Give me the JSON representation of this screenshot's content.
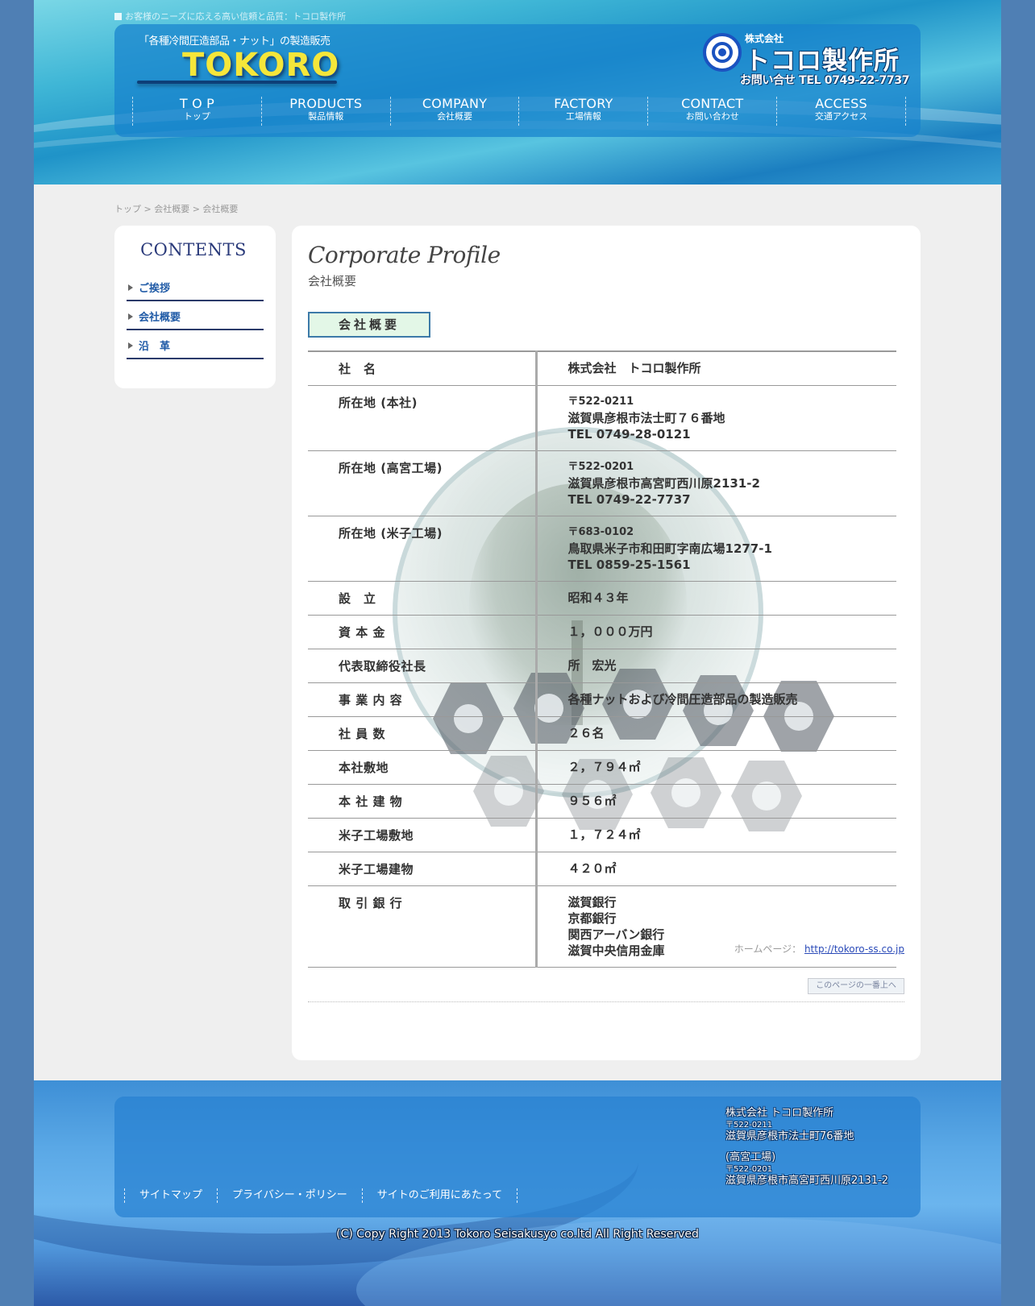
{
  "header": {
    "tagline": "お客様のニーズに応える高い信頼と品質：トコロ製作所",
    "logo_sub": "「各種冷間圧造部品・ナット」の製造販売",
    "logo_main": "TOKORO",
    "company_prefix": "株式会社",
    "company_name": "トコロ製作所",
    "contact_tel": "お問い合せ TEL 0749-22-7737",
    "nav": [
      {
        "en": "T O P",
        "jp": "トップ"
      },
      {
        "en": "PRODUCTS",
        "jp": "製品情報"
      },
      {
        "en": "COMPANY",
        "jp": "会社概要"
      },
      {
        "en": "FACTORY",
        "jp": "工場情報"
      },
      {
        "en": "CONTACT",
        "jp": "お問い合わせ"
      },
      {
        "en": "ACCESS",
        "jp": "交通アクセス"
      }
    ]
  },
  "breadcrumb": "トップ > 会社概要 > 会社概要",
  "sidebar": {
    "title": "CONTENTS",
    "items": [
      "ご挨拶",
      "会社概要",
      "沿　革"
    ]
  },
  "content": {
    "title": "Corporate Profile",
    "subtitle": "会社概要",
    "section_label": "会社概要",
    "rows": [
      {
        "key": "社　名",
        "lines": [
          "株式会社　トコロ製作所"
        ]
      },
      {
        "key": "所在地 (本社)",
        "zip": "〒522-0211",
        "lines": [
          "滋賀県彦根市法士町７６番地",
          "TEL 0749-28-0121"
        ]
      },
      {
        "key": "所在地 (高宮工場)",
        "zip": "〒522-0201",
        "lines": [
          "滋賀県彦根市高宮町西川原2131-2",
          "TEL 0749-22-7737"
        ]
      },
      {
        "key": "所在地 (米子工場)",
        "zip": "〒683-0102",
        "lines": [
          "鳥取県米子市和田町字南広場1277-1",
          "TEL 0859-25-1561"
        ]
      },
      {
        "key": "設　立",
        "lines": [
          "昭和４３年"
        ]
      },
      {
        "key": "資 本 金",
        "lines": [
          "１，０００万円"
        ]
      },
      {
        "key": "代表取締役社長",
        "lines": [
          "所　宏光"
        ]
      },
      {
        "key": "事 業 内 容",
        "lines": [
          "各種ナットおよび冷間圧造部品の製造販売"
        ]
      },
      {
        "key": "社 員 数",
        "lines": [
          "２６名"
        ]
      },
      {
        "key": "本社敷地",
        "lines": [
          "２，７９４㎡"
        ]
      },
      {
        "key": "本 社 建 物",
        "lines": [
          "９５６㎡"
        ]
      },
      {
        "key": "米子工場敷地",
        "lines": [
          "１，７２４㎡"
        ]
      },
      {
        "key": "米子工場建物",
        "lines": [
          "４２０㎡"
        ]
      },
      {
        "key": "取 引 銀 行",
        "lines": [
          "滋賀銀行",
          "京都銀行",
          "関西アーバン銀行",
          "滋賀中央信用金庫"
        ]
      }
    ],
    "homepage_label": "ホームページ：",
    "homepage_url": "http://tokoro-ss.co.jp",
    "pagetop_label": "このページの一番上へ"
  },
  "footer": {
    "nav": [
      "サイトマップ",
      "プライバシー・ポリシー",
      "サイトのご利用にあたって"
    ],
    "company": "株式会社 トコロ製作所",
    "zip1": "〒522-0211",
    "addr1": "滋賀県彦根市法士町76番地",
    "factory": "(高宮工場)",
    "zip2": "〒522-0201",
    "addr2": "滋賀県彦根市高宮町西川原2131-2",
    "copyright": "(C) Copy Right 2013 Tokoro Seisakusyo co.ltd All Right Reserved"
  }
}
